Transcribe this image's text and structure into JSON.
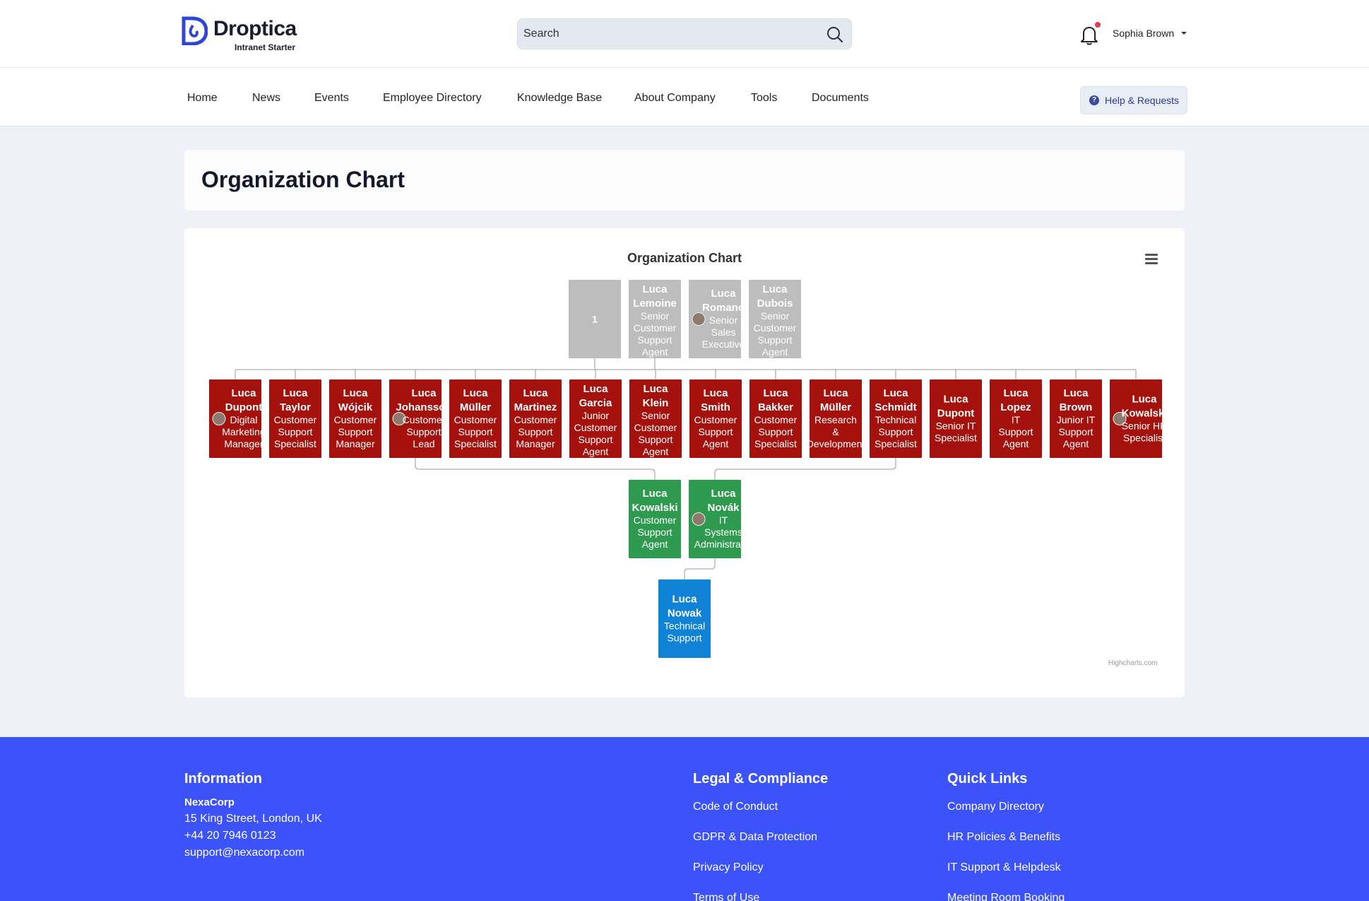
{
  "brand": {
    "name": "Droptica",
    "subtitle": "Intranet Starter"
  },
  "search": {
    "placeholder": "Search"
  },
  "user": {
    "name": "Sophia Brown"
  },
  "nav": {
    "items": [
      "Home",
      "News",
      "Events",
      "Employee Directory",
      "Knowledge Base",
      "About Company",
      "Tools",
      "Documents"
    ],
    "help_label": "Help & Requests"
  },
  "page": {
    "title": "Organization Chart"
  },
  "chart_data": {
    "type": "organization",
    "title": "Organization Chart",
    "credits": "Highcharts.com",
    "colors": {
      "level0": "#bdbdbd",
      "level1": "#a5120e",
      "level2": "#2e9a4f",
      "level3": "#1083d6"
    },
    "nodes": [
      {
        "id": "root",
        "name": "1",
        "title": "",
        "level": 0,
        "avatar": false
      },
      {
        "id": "lemoine",
        "name": "Luca Lemoine",
        "title": "Senior Customer Support Agent",
        "level": 0,
        "avatar": false
      },
      {
        "id": "romano",
        "name": "Luca Romano",
        "title": "Senior Sales Executive",
        "level": 0,
        "avatar": true
      },
      {
        "id": "dubois",
        "name": "Luca Dubois",
        "title": "Senior Customer Support Agent",
        "level": 0,
        "avatar": false
      },
      {
        "id": "dupont1",
        "name": "Luca Dupont",
        "title": "Digital Marketing Manager",
        "level": 1,
        "avatar": true
      },
      {
        "id": "taylor",
        "name": "Luca Taylor",
        "title": "Customer Support Specialist",
        "level": 1,
        "avatar": false
      },
      {
        "id": "wojcik",
        "name": "Luca Wójcik",
        "title": "Customer Support Manager",
        "level": 1,
        "avatar": false
      },
      {
        "id": "johansson",
        "name": "Luca Johansson",
        "title": "Customer Support Lead",
        "level": 1,
        "avatar": true
      },
      {
        "id": "muller1",
        "name": "Luca Müller",
        "title": "Customer Support Specialist",
        "level": 1,
        "avatar": false
      },
      {
        "id": "martinez",
        "name": "Luca Martinez",
        "title": "Customer Support Manager",
        "level": 1,
        "avatar": false
      },
      {
        "id": "garcia",
        "name": "Luca Garcia",
        "title": "Junior Customer Support Agent",
        "level": 1,
        "avatar": false
      },
      {
        "id": "klein",
        "name": "Luca Klein",
        "title": "Senior Customer Support Agent",
        "level": 1,
        "avatar": false
      },
      {
        "id": "smith",
        "name": "Luca Smith",
        "title": "Customer Support Agent",
        "level": 1,
        "avatar": false
      },
      {
        "id": "bakker",
        "name": "Luca Bakker",
        "title": "Customer Support Specialist",
        "level": 1,
        "avatar": false
      },
      {
        "id": "muller2",
        "name": "Luca Müller",
        "title": "Research & Development",
        "level": 1,
        "avatar": false
      },
      {
        "id": "schmidt",
        "name": "Luca Schmidt",
        "title": "Technical Support Specialist",
        "level": 1,
        "avatar": false
      },
      {
        "id": "dupont2",
        "name": "Luca Dupont",
        "title": "Senior IT Specialist",
        "level": 1,
        "avatar": false
      },
      {
        "id": "lopez",
        "name": "Luca Lopez",
        "title": "IT Support Agent",
        "level": 1,
        "avatar": false
      },
      {
        "id": "brown",
        "name": "Luca Brown",
        "title": "Junior IT Support Agent",
        "level": 1,
        "avatar": false
      },
      {
        "id": "kowalski1",
        "name": "Luca Kowalski",
        "title": "Senior HR Specialist",
        "level": 1,
        "avatar": true
      },
      {
        "id": "kowalski2",
        "name": "Luca Kowalski",
        "title": "Customer Support Agent",
        "level": 2,
        "avatar": false
      },
      {
        "id": "novak",
        "name": "Luca Novák",
        "title": "IT Systems Administrator",
        "level": 2,
        "avatar": true
      },
      {
        "id": "nowak",
        "name": "Luca Nowak",
        "title": "Technical Support",
        "level": 3,
        "avatar": false
      }
    ],
    "links": [
      [
        "root",
        "dupont1"
      ],
      [
        "root",
        "taylor"
      ],
      [
        "root",
        "wojcik"
      ],
      [
        "root",
        "johansson"
      ],
      [
        "root",
        "muller1"
      ],
      [
        "root",
        "martinez"
      ],
      [
        "root",
        "garcia"
      ],
      [
        "root",
        "klein"
      ],
      [
        "root",
        "smith"
      ],
      [
        "root",
        "bakker"
      ],
      [
        "root",
        "muller2"
      ],
      [
        "root",
        "schmidt"
      ],
      [
        "root",
        "dupont2"
      ],
      [
        "root",
        "lopez"
      ],
      [
        "root",
        "brown"
      ],
      [
        "root",
        "kowalski1"
      ],
      [
        "johansson",
        "kowalski2"
      ],
      [
        "schmidt",
        "novak"
      ],
      [
        "novak",
        "nowak"
      ]
    ]
  },
  "footer": {
    "information": {
      "heading": "Information",
      "company": "NexaCorp",
      "address": "15 King Street, London, UK",
      "phone": "+44 20 7946 0123",
      "email": "support@nexacorp.com"
    },
    "legal": {
      "heading": "Legal & Compliance",
      "links": [
        "Code of Conduct",
        "GDPR & Data Protection",
        "Privacy Policy",
        "Terms of Use"
      ]
    },
    "quick": {
      "heading": "Quick Links",
      "links": [
        "Company Directory",
        "HR Policies & Benefits",
        "IT Support & Helpdesk",
        "Meeting Room Booking"
      ]
    }
  }
}
